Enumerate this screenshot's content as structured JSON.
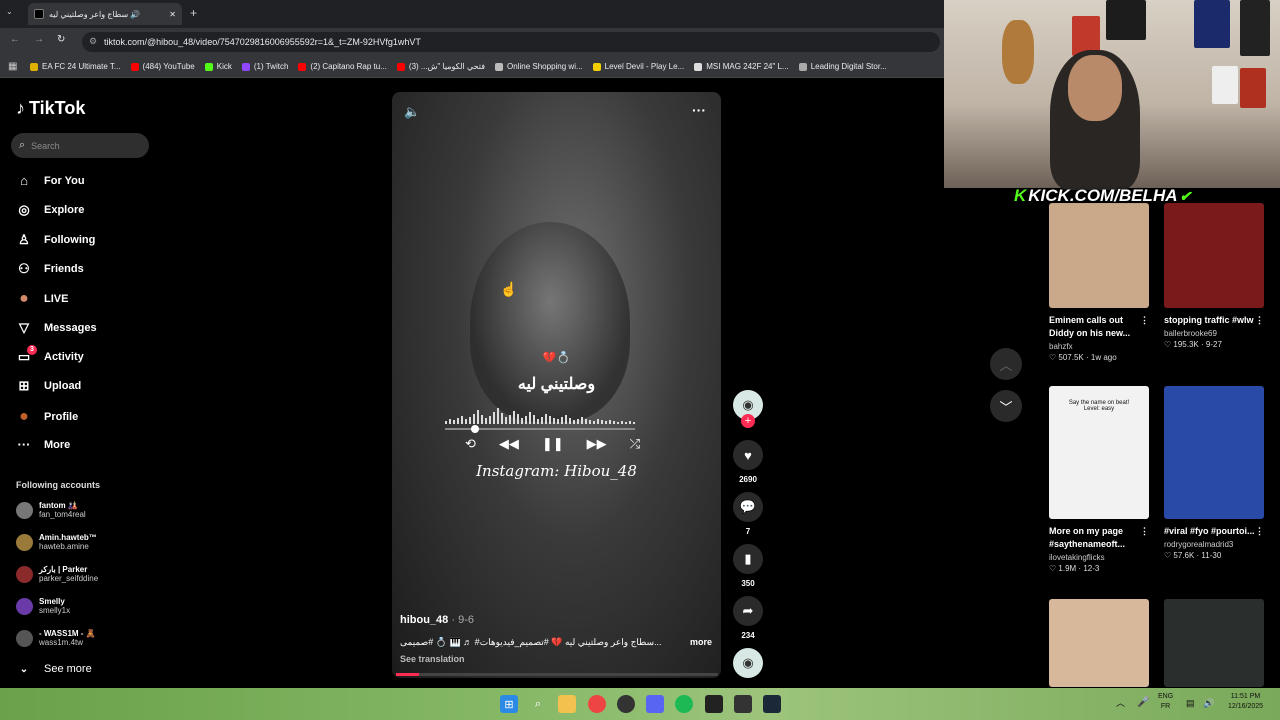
{
  "browser": {
    "tab_title": "سطاج واعر وصلتيني ليه 🔊",
    "new_tab": "+",
    "url": "tiktok.com/@hibou_48/video/7547029816006955592r=1&_t=ZM-92HVfg1whVT",
    "bookmarks": [
      {
        "label": "EA FC 24 Ultimate T...",
        "color": "#e0b000"
      },
      {
        "label": "(484) YouTube",
        "color": "#ff0000"
      },
      {
        "label": "Kick",
        "color": "#53fc18"
      },
      {
        "label": "(1) Twitch",
        "color": "#9146ff"
      },
      {
        "label": "(2) Capitano Rap tu...",
        "color": "#ff0000"
      },
      {
        "label": "فتحي الكوميا \"ش... (3)",
        "color": "#ff0000"
      },
      {
        "label": "Online Shopping wi...",
        "color": "#bbbbbb"
      },
      {
        "label": "Level Devil - Play Le...",
        "color": "#f2d000"
      },
      {
        "label": "MSI MAG 242F 24\" L...",
        "color": "#dddddd"
      },
      {
        "label": "Leading Digital Stor...",
        "color": "#aaaaaa"
      }
    ]
  },
  "tiktok": {
    "logo": "TikTok",
    "search_placeholder": "Search",
    "nav": [
      {
        "label": "For You",
        "icon": "home-icon",
        "glyph": "⌂"
      },
      {
        "label": "Explore",
        "icon": "compass-icon",
        "glyph": "◎"
      },
      {
        "label": "Following",
        "icon": "person-icon",
        "glyph": "♙"
      },
      {
        "label": "Friends",
        "icon": "friends-icon",
        "glyph": "⚇"
      },
      {
        "label": "LIVE",
        "icon": "live-avatar-icon",
        "glyph": "●"
      },
      {
        "label": "Messages",
        "icon": "send-icon",
        "glyph": "▽"
      },
      {
        "label": "Activity",
        "icon": "activity-icon",
        "glyph": "▭"
      },
      {
        "label": "Upload",
        "icon": "upload-icon",
        "glyph": "⊞"
      },
      {
        "label": "Profile",
        "icon": "profile-avatar-icon",
        "glyph": "●"
      },
      {
        "label": "More",
        "icon": "more-icon",
        "glyph": "···"
      }
    ],
    "activity_badge": "3",
    "following_title": "Following accounts",
    "accounts": [
      {
        "name": "fantom 🎎",
        "handle": "fan_tom4real"
      },
      {
        "name": "Amin.hawteb™",
        "handle": "hawteb.amine"
      },
      {
        "name": "بارکر | Parker",
        "handle": "parker_seifddine"
      },
      {
        "name": "Smelly",
        "handle": "smelly1x"
      },
      {
        "name": "- WASS1M - 🧸",
        "handle": "wass1m.4tw"
      }
    ],
    "see_more": "See more"
  },
  "video": {
    "arabic_caption": "وصلتيني ليه",
    "emoji_caption": "💔💍",
    "signature": "Instagram: Hibou_48",
    "username": "hibou_48",
    "date": "· 9-6",
    "description": "سطاج واعر وصلتيني ليه 💔 #تصميم_فيديوهات# ♬ 🎹 💍 #صميمى...",
    "more": "more",
    "see_translation": "See translation",
    "progress": 0.07
  },
  "actions": {
    "likes": "2690",
    "comments": "7",
    "saves": "350",
    "shares": "234"
  },
  "recommended": [
    {
      "title": "Eminem calls out Diddy on his new...",
      "author": "bahzfx",
      "likes": "507.5K",
      "date": "1w ago",
      "color": "#c9a98a"
    },
    {
      "title": "stopping traffic #wlw",
      "author": "ballerbrooke69",
      "likes": "195.3K",
      "date": "9-27",
      "color": "#7a1a1a"
    },
    {
      "title": "More on my page #saythenameoft...",
      "author": "ilovetakingflicks",
      "likes": "1.9M",
      "date": "12-3",
      "color": "#f2f2f2",
      "overlay": "Say the name on beat!\nLevel: easy"
    },
    {
      "title": "#viral #fyo #pourtoi...",
      "author": "rodrygorealmadrid3",
      "likes": "57.6K",
      "date": "11-30",
      "color": "#2a4aa8"
    },
    {
      "title": "",
      "author": "",
      "likes": "",
      "date": "",
      "color": "#d8b89a"
    },
    {
      "title": "",
      "author": "",
      "likes": "",
      "date": "",
      "color": "#2a2e2c"
    }
  ],
  "overlay": {
    "kick_text": "KICK.COM/BELHA"
  },
  "taskbar": {
    "lang_top": "ENG",
    "lang_bottom": "FR",
    "time": "11:51 PM",
    "date": "12/16/2025"
  }
}
